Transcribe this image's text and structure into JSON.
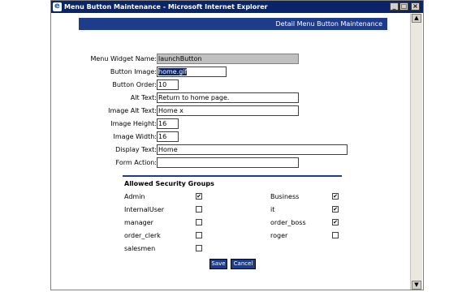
{
  "window": {
    "title": "Menu Button Maintenance - Microsoft Internet Explorer"
  },
  "header": {
    "title": "Detail Menu Button Maintenance"
  },
  "form": {
    "widget_name_label": "Menu Widget Name:",
    "widget_name_value": "launchButton",
    "button_image_label": "Button Image:",
    "button_image_value": "home.gif",
    "button_order_label": "Button Order:",
    "button_order_value": "10",
    "alt_text_label": "Alt Text:",
    "alt_text_value": "Return to home page.",
    "image_alt_text_label": "Image Alt Text:",
    "image_alt_text_value": "Home x",
    "image_height_label": "Image Height:",
    "image_height_value": "16",
    "image_width_label": "Image Width:",
    "image_width_value": "16",
    "display_text_label": "Display Text:",
    "display_text_value": "Home",
    "form_action_label": "Form Action:",
    "form_action_value": ""
  },
  "groups": {
    "title": "Allowed Security Groups",
    "items": [
      {
        "name": "Admin",
        "checked": true
      },
      {
        "name": "Business",
        "checked": true
      },
      {
        "name": "InternalUser",
        "checked": false
      },
      {
        "name": "it",
        "checked": true
      },
      {
        "name": "manager",
        "checked": false
      },
      {
        "name": "order_boss",
        "checked": true
      },
      {
        "name": "order_clerk",
        "checked": false
      },
      {
        "name": "roger",
        "checked": false
      },
      {
        "name": "salesmen",
        "checked": false
      }
    ]
  },
  "buttons": {
    "save": "Save",
    "cancel": "Cancel"
  }
}
